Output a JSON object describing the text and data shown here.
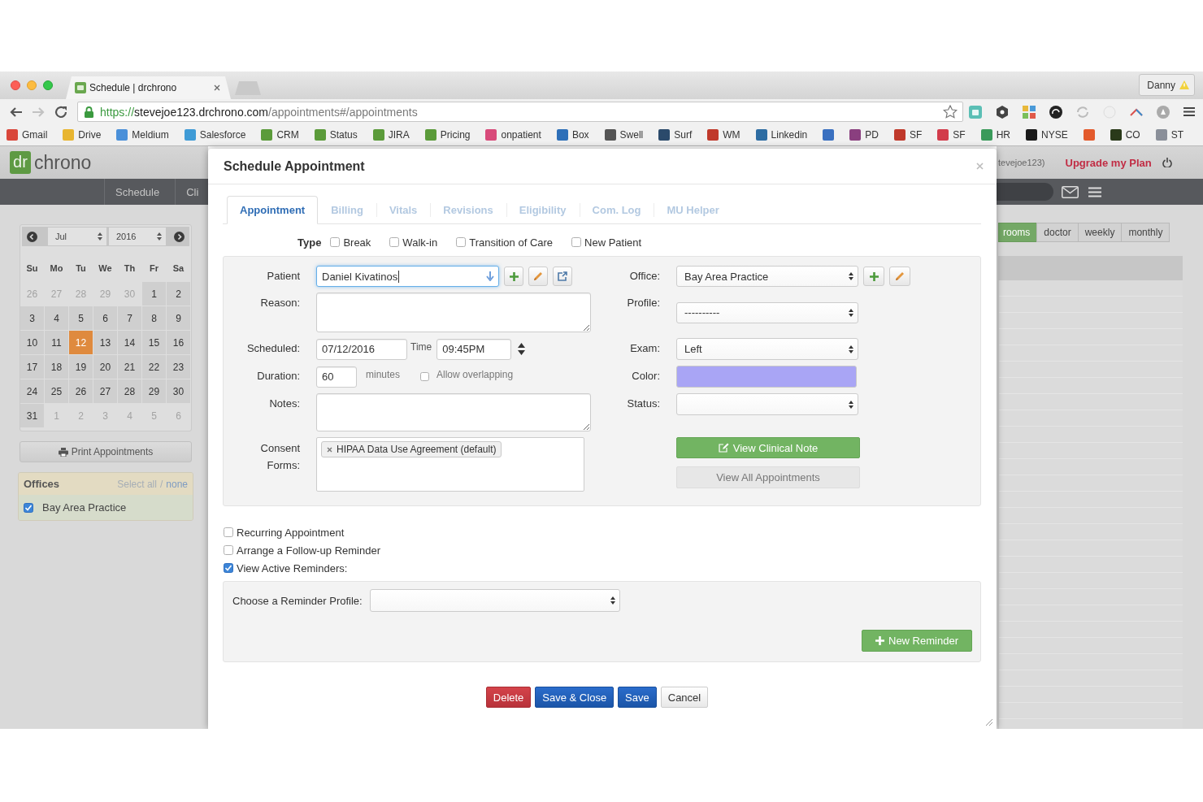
{
  "browser": {
    "tab": {
      "title": "Schedule | drchrono"
    },
    "profile": "Danny",
    "url": {
      "scheme": "https://",
      "host": "stevejoe123.drchrono.com",
      "path": "/appointments#/appointments"
    },
    "bookmarks": [
      {
        "label": "Gmail",
        "color": "#d9473b"
      },
      {
        "label": "Drive",
        "color": "#e8b530"
      },
      {
        "label": "Meldium",
        "color": "#4a90d9"
      },
      {
        "label": "Salesforce",
        "color": "#3f9bd6"
      },
      {
        "label": "CRM",
        "color": "#5b9b3a"
      },
      {
        "label": "Status",
        "color": "#5b9b3a"
      },
      {
        "label": "JIRA",
        "color": "#5b9b3a"
      },
      {
        "label": "Pricing",
        "color": "#5b9b3a"
      },
      {
        "label": "onpatient",
        "color": "#d84a7a"
      },
      {
        "label": "Box",
        "color": "#2d6fb8"
      },
      {
        "label": "Swell",
        "color": "#555555"
      },
      {
        "label": "Surf",
        "color": "#2b4a6b"
      },
      {
        "label": "WM",
        "color": "#c0392b"
      },
      {
        "label": "Linkedin",
        "color": "#2d6ca2"
      },
      {
        "color": "#3a70c0"
      },
      {
        "label": "PD",
        "color": "#8a3f7f"
      },
      {
        "label": "SF",
        "color": "#c0392b"
      },
      {
        "label": "SF",
        "color": "#d23c4b"
      },
      {
        "label": "HR",
        "color": "#3a9a5a"
      },
      {
        "label": "NYSE",
        "color": "#1a1a1a"
      },
      {
        "color": "#e35a2c"
      },
      {
        "label": "CO",
        "color": "#2a3a1a"
      },
      {
        "label": "ST",
        "color": "#8a8f99"
      }
    ]
  },
  "app": {
    "logo": {
      "mark": "dr",
      "name": "chrono"
    },
    "nav": [
      "Schedule",
      "Cli"
    ],
    "user": "tevejoe123)",
    "upgrade": "Upgrade my Plan",
    "calendar": {
      "month": "Jul",
      "year": "2016",
      "weekdays": [
        "Su",
        "Mo",
        "Tu",
        "We",
        "Th",
        "Fr",
        "Sa"
      ],
      "weeks": [
        [
          {
            "day": "26",
            "outside": true,
            "selected": false
          },
          {
            "day": "27",
            "outside": true,
            "selected": false
          },
          {
            "day": "28",
            "outside": true,
            "selected": false
          },
          {
            "day": "29",
            "outside": true,
            "selected": false
          },
          {
            "day": "30",
            "outside": true,
            "selected": false
          },
          {
            "day": "1",
            "outside": false,
            "selected": false
          },
          {
            "day": "2",
            "outside": false,
            "selected": false
          }
        ],
        [
          {
            "day": "3",
            "outside": false,
            "selected": false
          },
          {
            "day": "4",
            "outside": false,
            "selected": false
          },
          {
            "day": "5",
            "outside": false,
            "selected": false
          },
          {
            "day": "6",
            "outside": false,
            "selected": false
          },
          {
            "day": "7",
            "outside": false,
            "selected": false
          },
          {
            "day": "8",
            "outside": false,
            "selected": false
          },
          {
            "day": "9",
            "outside": false,
            "selected": false
          }
        ],
        [
          {
            "day": "10",
            "outside": false,
            "selected": false
          },
          {
            "day": "11",
            "outside": false,
            "selected": false
          },
          {
            "day": "12",
            "outside": false,
            "selected": true
          },
          {
            "day": "13",
            "outside": false,
            "selected": false
          },
          {
            "day": "14",
            "outside": false,
            "selected": false
          },
          {
            "day": "15",
            "outside": false,
            "selected": false
          },
          {
            "day": "16",
            "outside": false,
            "selected": false
          }
        ],
        [
          {
            "day": "17",
            "outside": false,
            "selected": false
          },
          {
            "day": "18",
            "outside": false,
            "selected": false
          },
          {
            "day": "19",
            "outside": false,
            "selected": false
          },
          {
            "day": "20",
            "outside": false,
            "selected": false
          },
          {
            "day": "21",
            "outside": false,
            "selected": false
          },
          {
            "day": "22",
            "outside": false,
            "selected": false
          },
          {
            "day": "23",
            "outside": false,
            "selected": false
          }
        ],
        [
          {
            "day": "24",
            "outside": false,
            "selected": false
          },
          {
            "day": "25",
            "outside": false,
            "selected": false
          },
          {
            "day": "26",
            "outside": false,
            "selected": false
          },
          {
            "day": "27",
            "outside": false,
            "selected": false
          },
          {
            "day": "28",
            "outside": false,
            "selected": false
          },
          {
            "day": "29",
            "outside": false,
            "selected": false
          },
          {
            "day": "30",
            "outside": false,
            "selected": false
          }
        ],
        [
          {
            "day": "31",
            "outside": false,
            "selected": false
          },
          {
            "day": "1",
            "outside": true,
            "selected": false
          },
          {
            "day": "2",
            "outside": true,
            "selected": false
          },
          {
            "day": "3",
            "outside": true,
            "selected": false
          },
          {
            "day": "4",
            "outside": true,
            "selected": false
          },
          {
            "day": "5",
            "outside": true,
            "selected": false
          },
          {
            "day": "6",
            "outside": true,
            "selected": false
          }
        ]
      ]
    },
    "print_button": "Print Appointments",
    "offices": {
      "title": "Offices",
      "select_all": "Select all",
      "separator": "/",
      "select_none": "none",
      "items": [
        {
          "label": "Bay Area Practice",
          "checked": true
        }
      ]
    },
    "views": [
      {
        "label": "rooms",
        "selected": true
      },
      {
        "label": "doctor",
        "selected": false
      },
      {
        "label": "weekly",
        "selected": false
      },
      {
        "label": "monthly",
        "selected": false
      }
    ]
  },
  "modal": {
    "title": "Schedule Appointment",
    "tabs": [
      {
        "label": "Appointment",
        "selected": true
      },
      {
        "label": "Billing",
        "selected": false
      },
      {
        "label": "Vitals",
        "selected": false
      },
      {
        "label": "Revisions",
        "selected": false
      },
      {
        "label": "Eligibility",
        "selected": false
      },
      {
        "label": "Com. Log",
        "selected": false
      },
      {
        "label": "MU Helper",
        "selected": false
      }
    ],
    "type": {
      "label": "Type",
      "options": [
        {
          "label": "Break",
          "checked": false
        },
        {
          "label": "Walk-in",
          "checked": false
        },
        {
          "label": "Transition of Care",
          "checked": false
        },
        {
          "label": "New Patient",
          "checked": false
        }
      ]
    },
    "form": {
      "patient": {
        "label": "Patient",
        "value": "Daniel Kivatinos",
        "focused": true
      },
      "reason": {
        "label": "Reason:"
      },
      "scheduled": {
        "label": "Scheduled:",
        "date": "07/12/2016",
        "time_label": "Time",
        "time": "09:45PM"
      },
      "duration": {
        "label": "Duration:",
        "value": "60",
        "unit": "minutes",
        "overlap": {
          "label": "Allow overlapping",
          "checked": false
        }
      },
      "notes": {
        "label": "Notes:"
      },
      "consent": {
        "label": "Consent Forms:",
        "tags": [
          "HIPAA Data Use Agreement (default)"
        ]
      },
      "office": {
        "label": "Office:",
        "value": "Bay Area Practice"
      },
      "profile": {
        "label": "Profile:",
        "value": "----------"
      },
      "exam": {
        "label": "Exam:",
        "value": "Left"
      },
      "color": {
        "label": "Color:",
        "color": "#a9a5f5"
      },
      "status": {
        "label": "Status:"
      },
      "clinical_note": "View Clinical Note",
      "all_appointments": "View All Appointments"
    },
    "options": [
      {
        "label": "Recurring Appointment",
        "checked": false
      },
      {
        "label": "Arrange a Follow-up Reminder",
        "checked": false
      },
      {
        "label": "View Active Reminders:",
        "checked": true
      }
    ],
    "reminder": {
      "label": "Choose a Reminder Profile:",
      "new_button": "New Reminder"
    },
    "buttons": [
      {
        "label": "Delete",
        "kind": "danger"
      },
      {
        "label": "Save & Close",
        "kind": "primary"
      },
      {
        "label": "Save",
        "kind": "primary"
      },
      {
        "label": "Cancel",
        "kind": "default"
      }
    ]
  }
}
